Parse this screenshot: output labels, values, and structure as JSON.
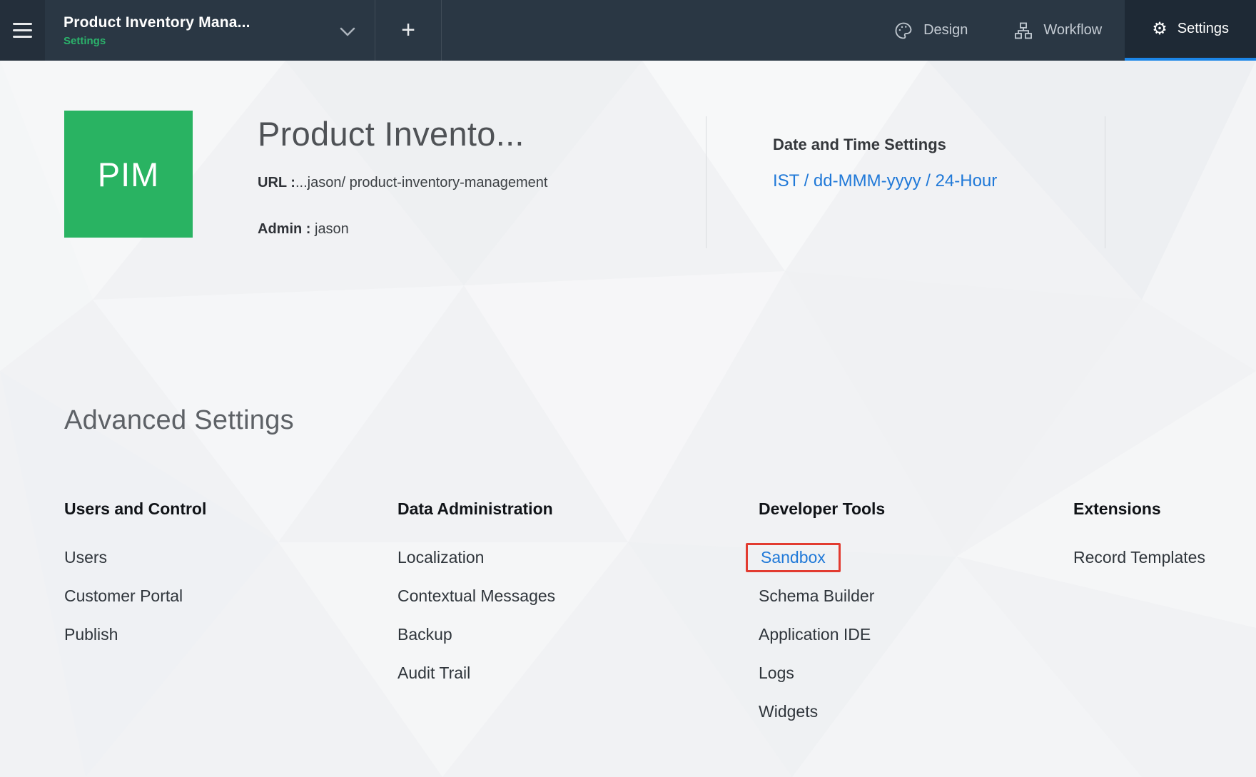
{
  "topbar": {
    "app_title": "Product Inventory Mana...",
    "app_subtitle": "Settings",
    "tabs": [
      {
        "label": "Design"
      },
      {
        "label": "Workflow"
      },
      {
        "label": "Settings"
      }
    ],
    "active_tab": "Settings"
  },
  "icons": {
    "plus_glyph": "+",
    "gear_glyph": "⚙"
  },
  "header": {
    "logo_text": "PIM",
    "title": "Product Invento...",
    "url_label": "URL :",
    "url_value": "...jason/ product-inventory-management",
    "admin_label": "Admin :",
    "admin_value": " jason",
    "datetime_heading": "Date and Time Settings",
    "datetime_value": "IST / dd-MMM-yyyy / 24-Hour"
  },
  "advanced": {
    "heading": "Advanced Settings",
    "columns": [
      {
        "title": "Users and Control",
        "items": [
          "Users",
          "Customer Portal",
          "Publish"
        ]
      },
      {
        "title": "Data Administration",
        "items": [
          "Localization",
          "Contextual Messages",
          "Backup",
          "Audit Trail"
        ]
      },
      {
        "title": "Developer Tools",
        "items": [
          "Sandbox",
          "Schema Builder",
          "Application IDE",
          "Logs",
          "Widgets"
        ]
      },
      {
        "title": "Extensions",
        "items": [
          "Record Templates"
        ]
      }
    ],
    "highlighted_item": "Sandbox"
  },
  "colors": {
    "topbar_bg": "#2a3744",
    "tab_active_bg": "#1e2935",
    "tab_active_underline": "#1c86e8",
    "accent_green": "#29b362",
    "link_blue": "#2079d8",
    "highlight_red": "#e23b30",
    "page_bg": "#f1f2f4"
  }
}
